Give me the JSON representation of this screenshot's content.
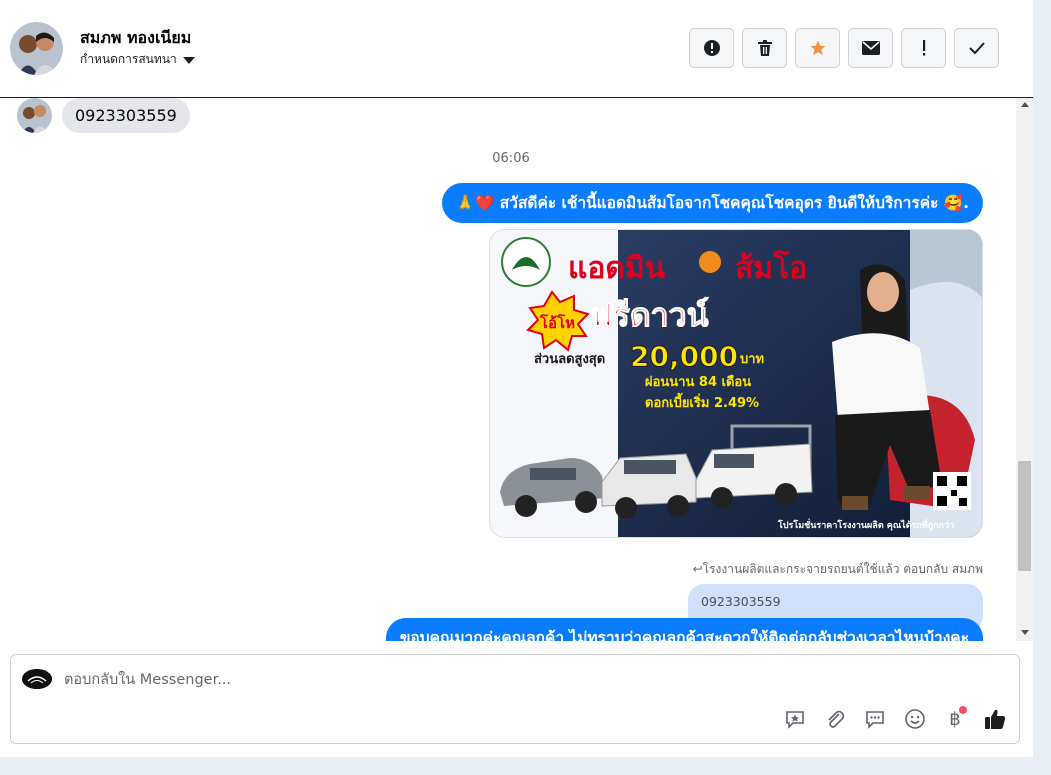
{
  "header": {
    "contact_name": "สมภพ ทองเนียม",
    "assign_label": "กำหนดการสนทนา",
    "actions": [
      {
        "name": "spam",
        "icon": "exclamation-circle-icon"
      },
      {
        "name": "delete",
        "icon": "trash-icon"
      },
      {
        "name": "star",
        "icon": "star-icon"
      },
      {
        "name": "mark-unread",
        "icon": "envelope-icon"
      },
      {
        "name": "follow-up",
        "icon": "exclamation-icon"
      },
      {
        "name": "done",
        "icon": "checkmark-icon"
      }
    ],
    "star_color": "#f7923b"
  },
  "conversation": {
    "incoming_message": "0923303559",
    "timestamp": "06:06",
    "outgoing_greeting": "🙏❤️ สวัสดีค่ะ เช้านี้แอดมินส้มโอจากโชคคุณโชคอุดร ยินดีให้บริการค่ะ 🥰.",
    "ad_image": {
      "brand_line1": "แอดมิน",
      "brand_line2": "ส้มโอ",
      "badge": "โอ้โห",
      "headline": "ฟรีดาวน์",
      "discount_label": "ส่วนลดสูงสุด",
      "discount_amount": "20,000",
      "currency": "บาท",
      "installment": "ผ่อนนาน 84 เดือน",
      "interest": "ดอกเบี้ยเริ่ม 2.49%",
      "footer": "โปรโมชั่นราคาโรงงานผลิต คุณได้รถที่ถูกกว่า"
    },
    "reply_note": "↩โรงงานผลิตและกระจายรถยนต์ใช้แล้ว ตอบกลับ สมภพ",
    "quoted_text": "0923303559",
    "outgoing_partial": "ขอบคุณมากค่ะคุณลูกค้า ไม่ทราบว่าคุณลูกค้าสะดวกให้ติดต่อกลับช่วงเวลาไหนบ้างคะ"
  },
  "composer": {
    "placeholder": "ตอบกลับใน Messenger...",
    "tools": [
      "saved-reply-icon",
      "paperclip-icon",
      "chat-bubble-icon",
      "emoji-icon",
      "baht-icon",
      "thumbs-up-icon"
    ]
  },
  "colors": {
    "outgoing_bubble": "#0a7cff",
    "incoming_bubble": "#e4e6eb",
    "quoted_bubble": "#cfe0fa"
  }
}
